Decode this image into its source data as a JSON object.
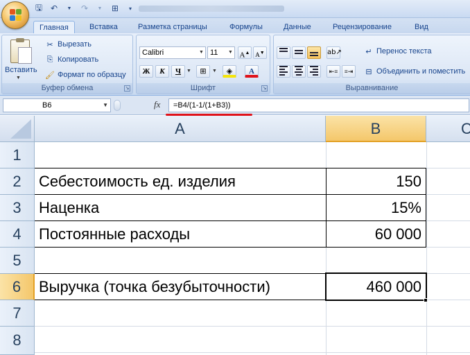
{
  "quick_access": {
    "save": "save-icon",
    "undo": "undo-icon",
    "redo": "redo-icon"
  },
  "tabs": [
    {
      "label": "Главная",
      "active": true
    },
    {
      "label": "Вставка"
    },
    {
      "label": "Разметка страницы"
    },
    {
      "label": "Формулы"
    },
    {
      "label": "Данные"
    },
    {
      "label": "Рецензирование"
    },
    {
      "label": "Вид"
    }
  ],
  "clipboard": {
    "paste": "Вставить",
    "cut": "Вырезать",
    "copy": "Копировать",
    "format_painter": "Формат по образцу",
    "group_label": "Буфер обмена"
  },
  "font": {
    "name": "Calibri",
    "size": "11",
    "bold": "Ж",
    "italic": "К",
    "underline": "Ч",
    "group_label": "Шрифт"
  },
  "alignment": {
    "wrap_text": "Перенос текста",
    "merge_center": "Объединить и поместить",
    "group_label": "Выравнивание"
  },
  "formula_bar": {
    "name_box": "B6",
    "fx": "fx",
    "formula": "=B4/(1-1/(1+B3))"
  },
  "sheet": {
    "columns": [
      "A",
      "B",
      "C"
    ],
    "selected_column": "B",
    "rows": [
      "1",
      "2",
      "3",
      "4",
      "5",
      "6",
      "7",
      "8"
    ],
    "selected_row": "6",
    "cells": {
      "A2": "Себестоимость ед. изделия",
      "B2": "150",
      "A3": "Наценка",
      "B3": "15%",
      "A4": "Постоянные расходы",
      "B4": "60 000",
      "A6": "Выручка (точка безубыточности)",
      "B6": "460 000"
    }
  }
}
